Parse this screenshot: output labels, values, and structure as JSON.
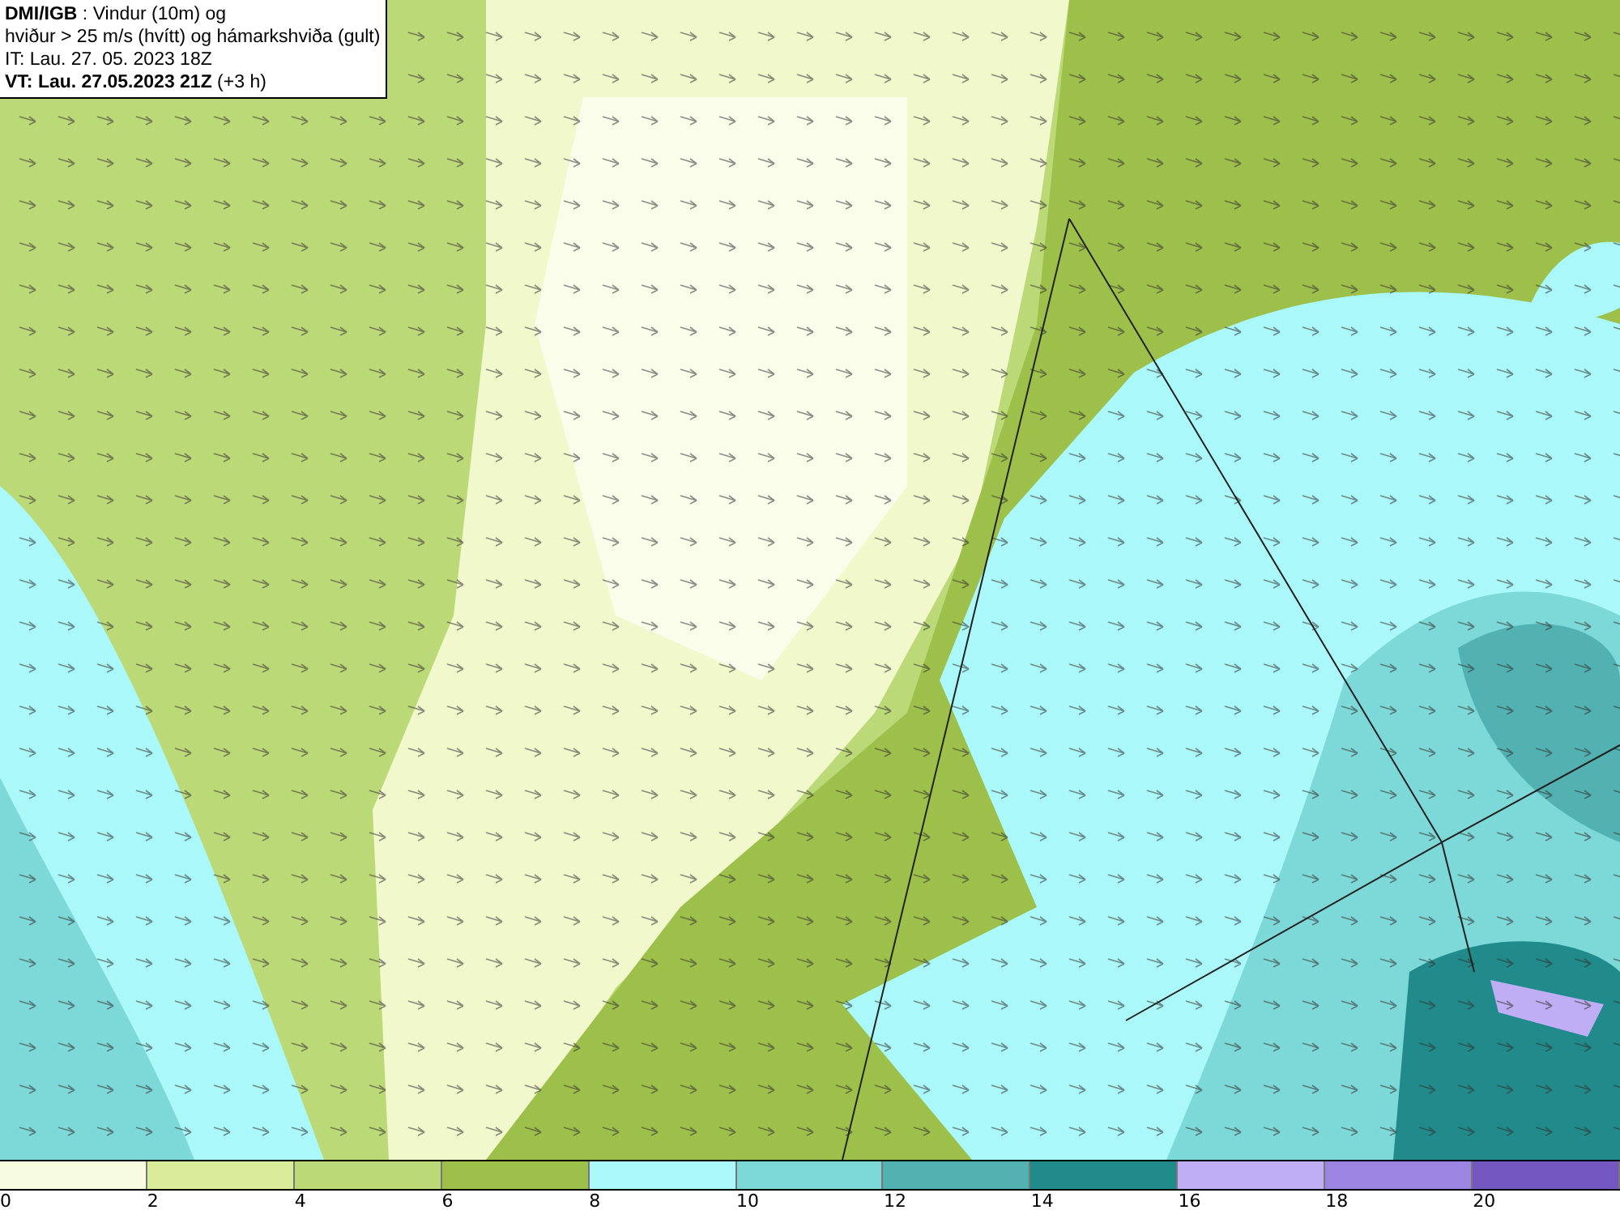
{
  "title_box": {
    "lines": [
      "**DMI/IGB** : Vindur (10m) og",
      "hviður > 25 m/s (hvítt) og hámarkshviða (gult)",
      "IT: Lau. 27. 05. 2023 18Z",
      "**VT: Lau. 27.05.2023 21Z** (+3 h)"
    ]
  },
  "legend": {
    "bins": [
      {
        "color": "#f7fbe0",
        "label": "0"
      },
      {
        "color": "#d8ec9a",
        "label": "2"
      },
      {
        "color": "#bcd977",
        "label": "4"
      },
      {
        "color": "#9dc04a",
        "label": "6"
      },
      {
        "color": "#aaf8fa",
        "label": "8"
      },
      {
        "color": "#7dd8d8",
        "label": "10"
      },
      {
        "color": "#52b2b2",
        "label": "12"
      },
      {
        "color": "#218a8a",
        "label": "14"
      },
      {
        "color": "#c0aef5",
        "label": "16"
      },
      {
        "color": "#9b85e0",
        "label": "18"
      },
      {
        "color": "#7457c0",
        "label": "20"
      }
    ]
  }
}
